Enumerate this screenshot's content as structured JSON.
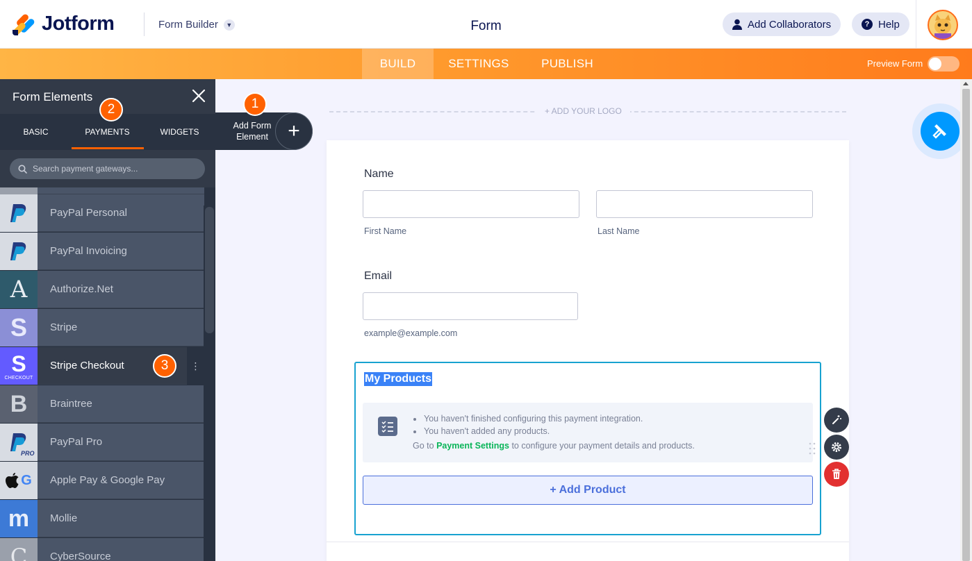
{
  "brand": {
    "name": "Jotform"
  },
  "header": {
    "menu_label": "Form Builder",
    "title": "Form",
    "collab_label": "Add Collaborators",
    "help_label": "Help"
  },
  "nav": {
    "tabs": [
      {
        "label": "BUILD"
      },
      {
        "label": "SETTINGS"
      },
      {
        "label": "PUBLISH"
      }
    ],
    "preview_label": "Preview Form"
  },
  "panel": {
    "title": "Form Elements",
    "tabs": [
      {
        "label": "BASIC"
      },
      {
        "label": "PAYMENTS"
      },
      {
        "label": "WIDGETS"
      }
    ],
    "search_placeholder": "Search payment gateways...",
    "items": [
      {
        "label": "PayPal Personal",
        "tile_text": "P",
        "tile_color": "#d8dce3"
      },
      {
        "label": "PayPal Invoicing",
        "tile_text": "P",
        "tile_color": "#d8dce3"
      },
      {
        "label": "Authorize.Net",
        "tile_text": "A",
        "tile_color": "#2e5a6b"
      },
      {
        "label": "Stripe",
        "tile_text": "S",
        "tile_color": "#8b8fd6"
      },
      {
        "label": "Stripe Checkout",
        "tile_text": "S",
        "tile_sub": "CHECKOUT",
        "tile_color": "#635bff"
      },
      {
        "label": "Braintree",
        "tile_text": "B",
        "tile_color": "#5a6170"
      },
      {
        "label": "PayPal Pro",
        "tile_text": "P",
        "tile_sub": "PRO",
        "tile_color": "#d8dce3"
      },
      {
        "label": "Apple Pay & Google Pay",
        "tile_text": "",
        "tile_color": "#d8dce3"
      },
      {
        "label": "Mollie",
        "tile_text": "m",
        "tile_color": "#3d7ad6"
      },
      {
        "label": "CyberSource",
        "tile_text": "C",
        "tile_color": "#9aa0ab"
      }
    ]
  },
  "badges": [
    "1",
    "2",
    "3"
  ],
  "add_element": {
    "label": "Add Form Element"
  },
  "canvas": {
    "add_logo": "+ ADD YOUR LOGO",
    "name_label": "Name",
    "first_name": "First Name",
    "last_name": "Last Name",
    "email_label": "Email",
    "email_sub": "example@example.com",
    "products_title": "My Products",
    "notice_1": "You haven't finished configuring this payment integration.",
    "notice_2": "You haven't added any products.",
    "goto_pre": "Go to",
    "goto_link": "Payment Settings",
    "goto_post": "to configure your payment details and products.",
    "add_product": "+ Add Product"
  },
  "colors": {
    "accent_orange": "#ff6100",
    "panel_bg": "#293241",
    "selection_border": "#18a2d0",
    "delete_red": "#e23030"
  }
}
